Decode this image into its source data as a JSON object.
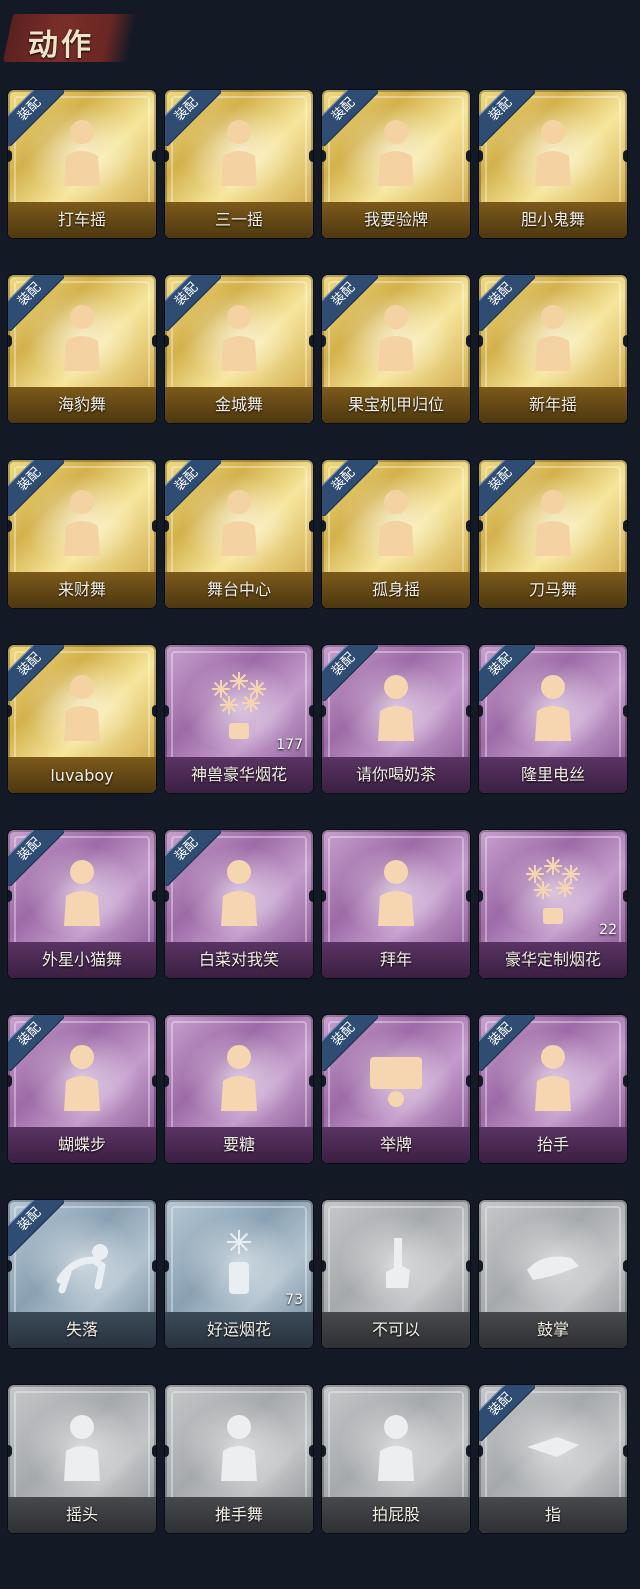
{
  "header": {
    "title": "动作"
  },
  "equip_badge": "装配",
  "actions": [
    {
      "label": "打车摇",
      "rarity": "gold",
      "equipped": true,
      "icon": "figure-icon"
    },
    {
      "label": "三一摇",
      "rarity": "gold",
      "equipped": true,
      "icon": "figure-icon"
    },
    {
      "label": "我要验牌",
      "rarity": "gold",
      "equipped": true,
      "icon": "figure-icon"
    },
    {
      "label": "胆小鬼舞",
      "rarity": "gold",
      "equipped": true,
      "icon": "figure-icon"
    },
    {
      "label": "海豹舞",
      "rarity": "gold",
      "equipped": true,
      "icon": "figure-icon"
    },
    {
      "label": "金城舞",
      "rarity": "gold",
      "equipped": true,
      "icon": "figure-icon"
    },
    {
      "label": "果宝机甲归位",
      "rarity": "gold",
      "equipped": true,
      "icon": "figure-icon"
    },
    {
      "label": "新年摇",
      "rarity": "gold",
      "equipped": true,
      "icon": "figure-icon"
    },
    {
      "label": "来财舞",
      "rarity": "gold",
      "equipped": true,
      "icon": "figure-icon"
    },
    {
      "label": "舞台中心",
      "rarity": "gold",
      "equipped": true,
      "icon": "figure-icon"
    },
    {
      "label": "孤身摇",
      "rarity": "gold",
      "equipped": true,
      "icon": "figure-icon"
    },
    {
      "label": "刀马舞",
      "rarity": "gold",
      "equipped": true,
      "icon": "figure-icon"
    },
    {
      "label": "luvaboy",
      "rarity": "gold",
      "equipped": true,
      "icon": "figure-icon"
    },
    {
      "label": "神兽豪华烟花",
      "rarity": "purple",
      "equipped": false,
      "icon": "fireworks-icon",
      "count": "177"
    },
    {
      "label": "请你喝奶茶",
      "rarity": "purple",
      "equipped": true,
      "icon": "figure-icon"
    },
    {
      "label": "隆里电丝",
      "rarity": "purple",
      "equipped": true,
      "icon": "figure-icon"
    },
    {
      "label": "外星小猫舞",
      "rarity": "purple",
      "equipped": true,
      "icon": "figure-icon"
    },
    {
      "label": "白菜对我笑",
      "rarity": "purple",
      "equipped": true,
      "icon": "figure-icon"
    },
    {
      "label": "拜年",
      "rarity": "purple",
      "equipped": false,
      "icon": "figure-icon"
    },
    {
      "label": "豪华定制烟花",
      "rarity": "purple",
      "equipped": false,
      "icon": "fireworks-icon",
      "count": "22"
    },
    {
      "label": "蝴蝶步",
      "rarity": "purple",
      "equipped": true,
      "icon": "figure-icon"
    },
    {
      "label": "要糖",
      "rarity": "purple",
      "equipped": false,
      "icon": "figure-icon"
    },
    {
      "label": "举牌",
      "rarity": "purple",
      "equipped": true,
      "icon": "sign-icon"
    },
    {
      "label": "抬手",
      "rarity": "purple",
      "equipped": true,
      "icon": "figure-icon"
    },
    {
      "label": "失落",
      "rarity": "blue",
      "equipped": true,
      "icon": "crawl-figure-icon"
    },
    {
      "label": "好运烟花",
      "rarity": "blue",
      "equipped": false,
      "icon": "firecracker-icon",
      "count": "73"
    },
    {
      "label": "不可以",
      "rarity": "gray",
      "equipped": false,
      "icon": "finger-icon"
    },
    {
      "label": "鼓掌",
      "rarity": "gray",
      "equipped": false,
      "icon": "clap-icon"
    },
    {
      "label": "摇头",
      "rarity": "gray",
      "equipped": false,
      "icon": "figure-icon"
    },
    {
      "label": "推手舞",
      "rarity": "gray",
      "equipped": false,
      "icon": "figure-icon"
    },
    {
      "label": "拍屁股",
      "rarity": "gray",
      "equipped": false,
      "icon": "figure-icon"
    },
    {
      "label": "指",
      "rarity": "gray",
      "equipped": true,
      "icon": "point-icon"
    }
  ]
}
